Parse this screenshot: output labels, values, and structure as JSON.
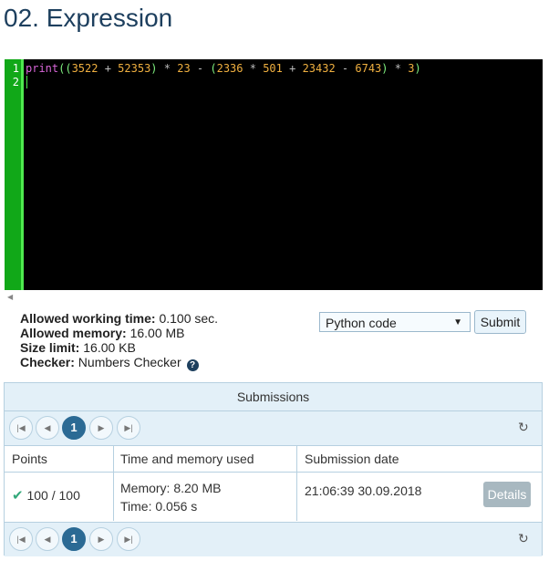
{
  "page": {
    "title": "02. Expression"
  },
  "editor": {
    "line_numbers": [
      "1",
      "2"
    ],
    "code_tokens": [
      {
        "text": "print",
        "color": "#d966d9"
      },
      {
        "text": "((",
        "color": "#7ff07f"
      },
      {
        "text": "3522",
        "color": "#f0b040"
      },
      {
        "text": " + ",
        "color": "#bbbbbb"
      },
      {
        "text": "52353",
        "color": "#f0b040"
      },
      {
        "text": ")",
        "color": "#7ff07f"
      },
      {
        "text": " * ",
        "color": "#bbbbbb"
      },
      {
        "text": "23",
        "color": "#f0b040"
      },
      {
        "text": " - ",
        "color": "#bbbbbb"
      },
      {
        "text": "(",
        "color": "#7ff07f"
      },
      {
        "text": "2336",
        "color": "#f0b040"
      },
      {
        "text": " * ",
        "color": "#bbbbbb"
      },
      {
        "text": "501",
        "color": "#f0b040"
      },
      {
        "text": " + ",
        "color": "#bbbbbb"
      },
      {
        "text": "23432",
        "color": "#f0b040"
      },
      {
        "text": " - ",
        "color": "#bbbbbb"
      },
      {
        "text": "6743",
        "color": "#f0b040"
      },
      {
        "text": ")",
        "color": "#7ff07f"
      },
      {
        "text": " * ",
        "color": "#bbbbbb"
      },
      {
        "text": "3",
        "color": "#f0b040"
      },
      {
        "text": ")",
        "color": "#7ff07f"
      }
    ],
    "gutter_color": "#11a818"
  },
  "limits": {
    "time_label": "Allowed working time:",
    "time_value": " 0.100 sec.",
    "memory_label": "Allowed memory:",
    "memory_value": " 16.00 MB",
    "size_label": "Size limit:",
    "size_value": " 16.00 KB",
    "checker_label": "Checker:",
    "checker_value": " Numbers Checker",
    "help_glyph": "?"
  },
  "submit_form": {
    "language": "Python code",
    "dropdown_arrow": "▼",
    "submit_label": "Submit"
  },
  "submissions": {
    "header": "Submissions",
    "pager": {
      "first": "|◀",
      "prev": "◀",
      "current": "1",
      "next": "▶",
      "last": "▶|",
      "refresh": "↻"
    },
    "columns": [
      "Points",
      "Time and memory used",
      "Submission date"
    ],
    "rows": [
      {
        "check": "✔",
        "points": "100 / 100",
        "memory": "Memory: 8.20 MB",
        "time": "Time: 0.056 s",
        "date": "21:06:39 30.09.2018",
        "details_label": "Details"
      }
    ],
    "accent_color": "#2b6a94"
  }
}
